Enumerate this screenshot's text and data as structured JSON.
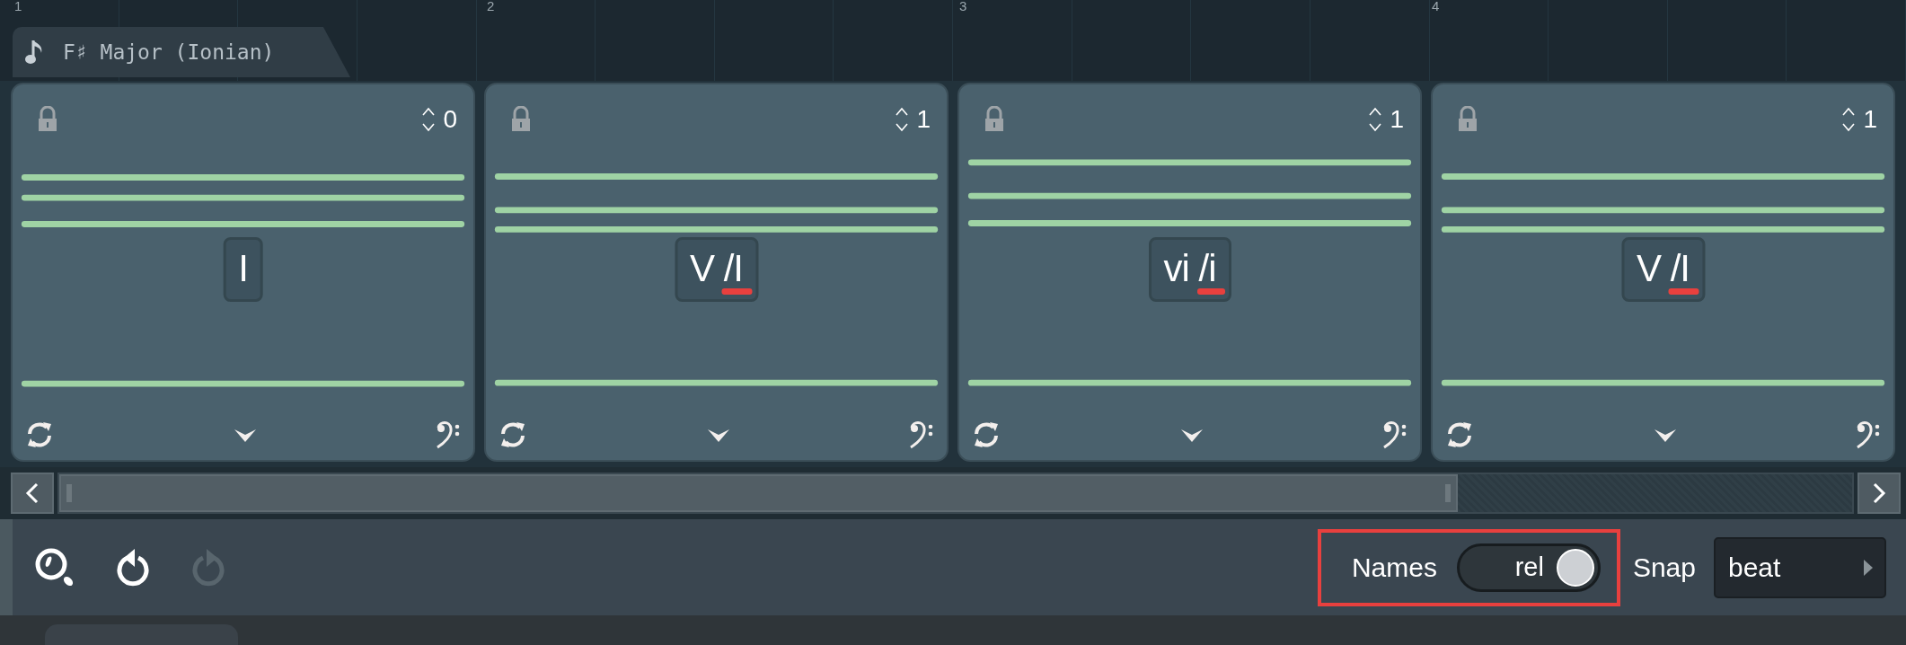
{
  "ruler": {
    "marks": [
      "1",
      "2",
      "3",
      "4"
    ]
  },
  "scale_tab": {
    "label": "F♯ Major (Ionian)"
  },
  "chords": [
    {
      "label": "I",
      "inversion": "0",
      "flagged": false
    },
    {
      "label": "V",
      "relative": "/I",
      "inversion": "1",
      "flagged": true
    },
    {
      "label": "vi",
      "relative": "/i",
      "inversion": "1",
      "flagged": true
    },
    {
      "label": "V",
      "relative": "/I",
      "inversion": "1",
      "flagged": true
    }
  ],
  "tools": [
    {
      "kind": "zoom",
      "disabled": false
    },
    {
      "kind": "undo",
      "disabled": false
    },
    {
      "kind": "redo",
      "disabled": true
    }
  ],
  "names": {
    "label": "Names",
    "value": "rel",
    "on": true,
    "highlighted": true
  },
  "snap": {
    "label": "Snap",
    "value": "beat"
  }
}
